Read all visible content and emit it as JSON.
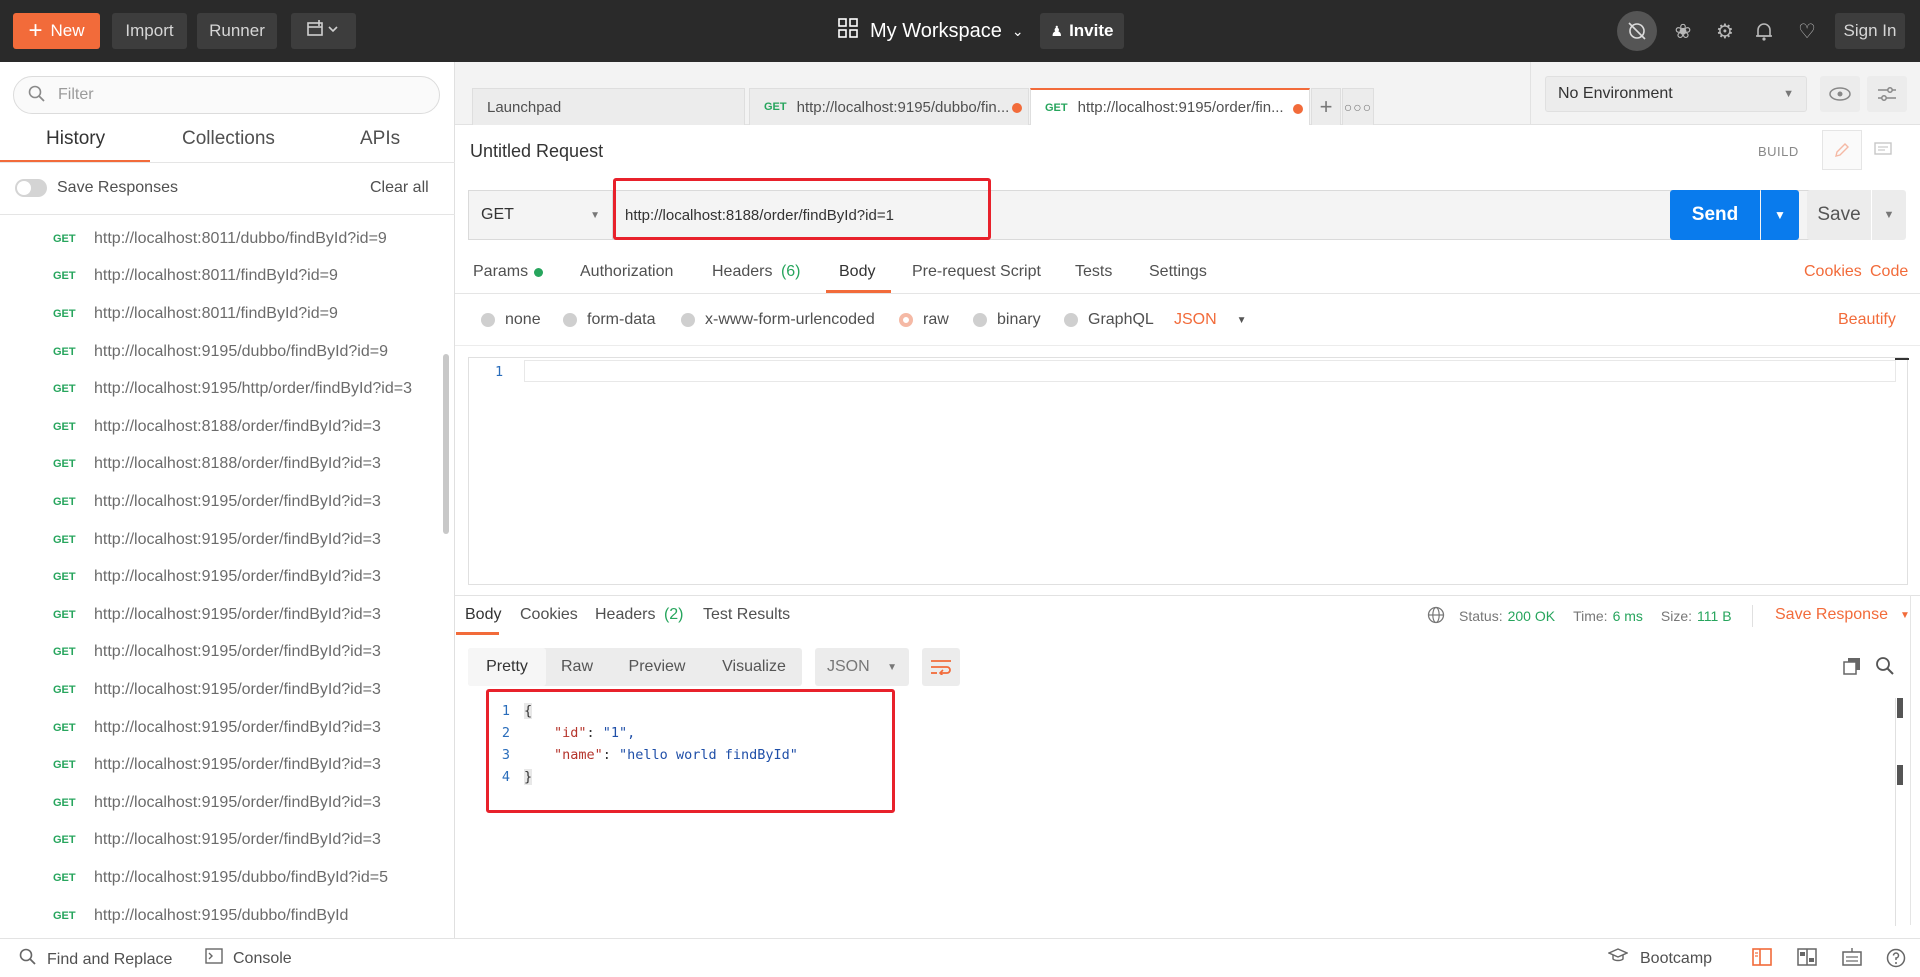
{
  "topbar": {
    "new_label": "New",
    "import_label": "Import",
    "runner_label": "Runner",
    "workspace_label": "My Workspace",
    "invite_label": "Invite",
    "signin_label": "Sign In"
  },
  "sidebar": {
    "filter_placeholder": "Filter",
    "tabs": [
      "History",
      "Collections",
      "APIs"
    ],
    "save_responses_label": "Save Responses",
    "clear_all_label": "Clear all",
    "history": [
      {
        "method": "GET",
        "url": "http://localhost:8011/dubbo/findById?id=9"
      },
      {
        "method": "GET",
        "url": "http://localhost:8011/findById?id=9"
      },
      {
        "method": "GET",
        "url": "http://localhost:8011/findById?id=9"
      },
      {
        "method": "GET",
        "url": "http://localhost:9195/dubbo/findById?id=9"
      },
      {
        "method": "GET",
        "url": "http://localhost:9195/http/order/findById?id=3"
      },
      {
        "method": "GET",
        "url": "http://localhost:8188/order/findById?id=3"
      },
      {
        "method": "GET",
        "url": "http://localhost:8188/order/findById?id=3"
      },
      {
        "method": "GET",
        "url": "http://localhost:9195/order/findById?id=3"
      },
      {
        "method": "GET",
        "url": "http://localhost:9195/order/findById?id=3"
      },
      {
        "method": "GET",
        "url": "http://localhost:9195/order/findById?id=3"
      },
      {
        "method": "GET",
        "url": "http://localhost:9195/order/findById?id=3"
      },
      {
        "method": "GET",
        "url": "http://localhost:9195/order/findById?id=3"
      },
      {
        "method": "GET",
        "url": "http://localhost:9195/order/findById?id=3"
      },
      {
        "method": "GET",
        "url": "http://localhost:9195/order/findById?id=3"
      },
      {
        "method": "GET",
        "url": "http://localhost:9195/order/findById?id=3"
      },
      {
        "method": "GET",
        "url": "http://localhost:9195/order/findById?id=3"
      },
      {
        "method": "GET",
        "url": "http://localhost:9195/order/findById?id=3"
      },
      {
        "method": "GET",
        "url": "http://localhost:9195/dubbo/findById?id=5"
      },
      {
        "method": "GET",
        "url": "http://localhost:9195/dubbo/findById"
      }
    ]
  },
  "request_tabs": [
    {
      "method": "",
      "label": "Launchpad"
    },
    {
      "method": "GET",
      "label": "http://localhost:9195/dubbo/fin..."
    },
    {
      "method": "GET",
      "label": "http://localhost:9195/order/fin..."
    }
  ],
  "environment": {
    "selected": "No Environment"
  },
  "request": {
    "title": "Untitled Request",
    "build_label": "BUILD",
    "method": "GET",
    "url": "http://localhost:8188/order/findById?id=1",
    "send_label": "Send",
    "save_label": "Save",
    "tabs": {
      "params": "Params",
      "authorization": "Authorization",
      "headers": "Headers",
      "headers_count": "(6)",
      "body": "Body",
      "prerequest": "Pre-request Script",
      "tests": "Tests",
      "settings": "Settings",
      "cookies": "Cookies",
      "code": "Code"
    },
    "body_options": [
      "none",
      "form-data",
      "x-www-form-urlencoded",
      "raw",
      "binary",
      "GraphQL"
    ],
    "body_format": "JSON",
    "beautify_label": "Beautify",
    "body_line": "1"
  },
  "response": {
    "tabs": {
      "body": "Body",
      "cookies": "Cookies",
      "headers": "Headers",
      "headers_count": "(2)",
      "test_results": "Test Results"
    },
    "status_label": "Status:",
    "status_value": "200 OK",
    "time_label": "Time:",
    "time_value": "6 ms",
    "size_label": "Size:",
    "size_value": "111 B",
    "save_response_label": "Save Response",
    "view_tabs": [
      "Pretty",
      "Raw",
      "Preview",
      "Visualize"
    ],
    "format": "JSON",
    "lines": [
      {
        "n": "1",
        "text": "{"
      },
      {
        "n": "2",
        "key": "\"id\"",
        "val": "\"1\","
      },
      {
        "n": "3",
        "key": "\"name\"",
        "val": "\"hello world findById\""
      },
      {
        "n": "4",
        "text": "}"
      }
    ]
  },
  "bottombar": {
    "find_replace_label": "Find and Replace",
    "console_label": "Console",
    "bootcamp_label": "Bootcamp"
  },
  "colors": {
    "accent": "#f26b3a",
    "send_blue": "#097bed",
    "success_green": "#27a55d",
    "highlight_red": "#e8212b"
  }
}
